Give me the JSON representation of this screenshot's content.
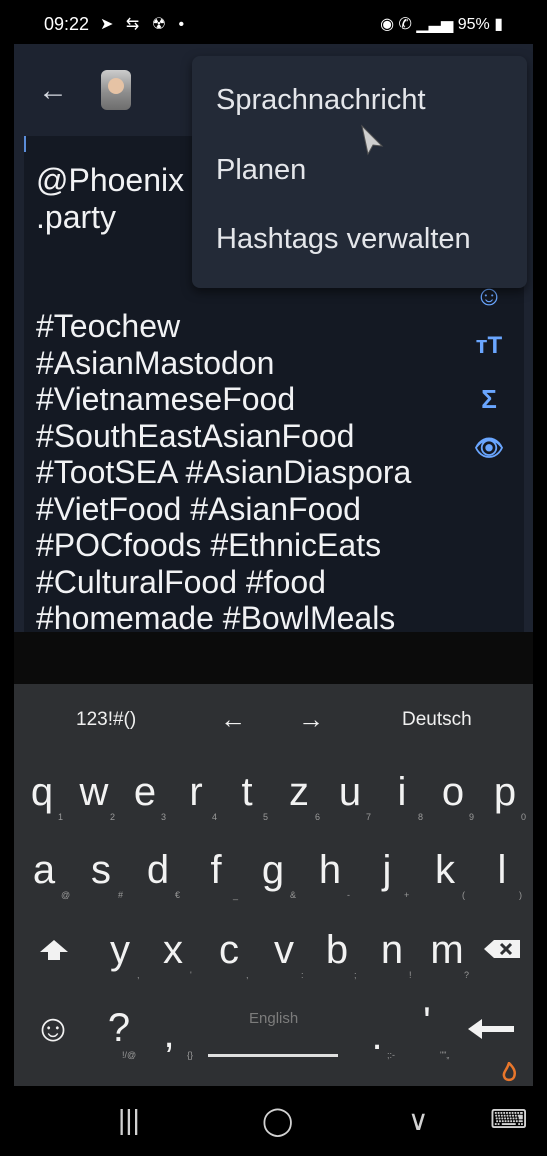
{
  "status_bar": {
    "time": "09:22",
    "left_icons": "➤ ⇆ ☢ •",
    "battery": "95%"
  },
  "compose": {
    "text": "@Phoenix\n.party\n\n\n#Teochew\n#AsianMastodon\n#VietnameseFood\n#SouthEastAsianFood\n#TootSEA #AsianDiaspora\n#VietFood #AsianFood\n#POCfoods #EthnicEats\n#CulturalFood #food\n#homemade #BowlMeals"
  },
  "menu": {
    "items": [
      "Sprachnachricht",
      "Planen",
      "Hashtags verwalten"
    ]
  },
  "toolbar": {
    "emoji": "☺",
    "text_size": "тT",
    "formula": "Σ",
    "preview": "👁"
  },
  "keyboard": {
    "top_row": {
      "symbols": "123!#()",
      "left_arrow": "←",
      "right_arrow": "→",
      "language": "Deutsch"
    },
    "row1": [
      "q",
      "w",
      "e",
      "r",
      "t",
      "z",
      "u",
      "i",
      "o",
      "p"
    ],
    "row1_hints": [
      "1",
      "2",
      "3",
      "4",
      "5",
      "6",
      "7",
      "8",
      "9",
      "0"
    ],
    "row2": [
      "a",
      "s",
      "d",
      "f",
      "g",
      "h",
      "j",
      "k",
      "l"
    ],
    "row2_hints": [
      "@",
      "#",
      "€",
      "_",
      "&",
      "-",
      "+",
      "(",
      ")"
    ],
    "row3": [
      "y",
      "x",
      "c",
      "v",
      "b",
      "n",
      "m"
    ],
    "row3_hints": [
      ",",
      "'",
      ",",
      ":",
      ";",
      "!",
      "?"
    ],
    "bottom": {
      "emoji": "☺",
      "question": "?",
      "question_hint": "!/@",
      "comma": ",",
      "comma_hint": "{}",
      "space_label": "English",
      "period": ".",
      "period_hint": ";:-",
      "apostrophe": "'",
      "apostrophe_hint": "\"\"„"
    }
  },
  "nav_bar": {
    "recent": "|||",
    "home": "◯",
    "back": "∨",
    "keyboard": "⌨"
  }
}
